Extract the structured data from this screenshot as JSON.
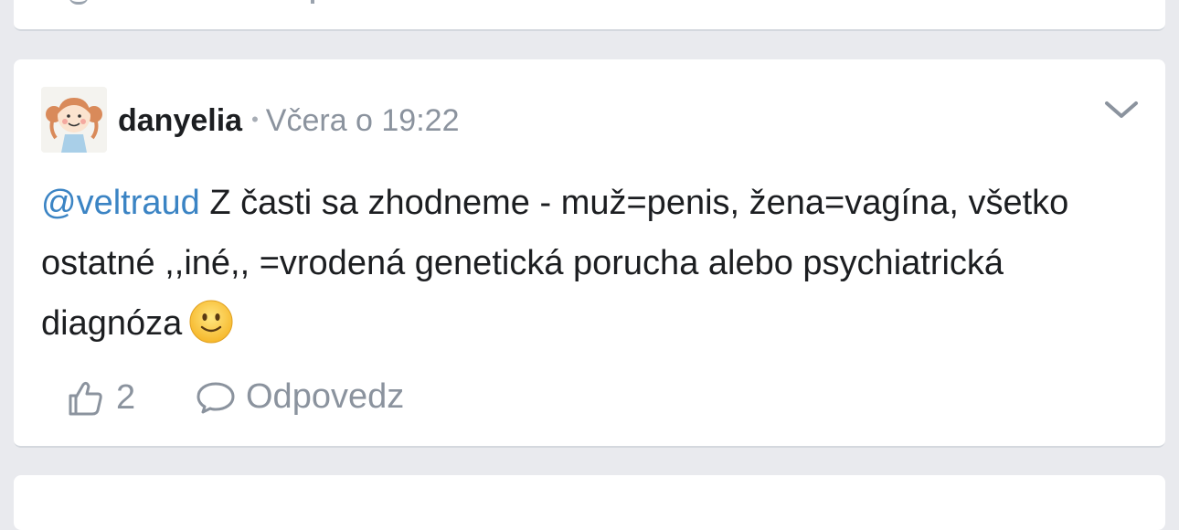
{
  "post": {
    "username": "danyelia",
    "separator": "•",
    "timestamp": "Včera o 19:22",
    "mention": "@veltraud",
    "text": " Z časti sa zhodneme - muž=penis, žena=vagína, všetko ostatné ,,iné,, =vrodená genetická porucha alebo psychiatrická diagnóza",
    "emoji": "slightly-smiling-face-icon",
    "like_count": "2",
    "reply_label": "Odpovedz"
  },
  "colors": {
    "mention": "#3b84c4",
    "meta": "#8b939e",
    "background": "#e9eaee"
  }
}
